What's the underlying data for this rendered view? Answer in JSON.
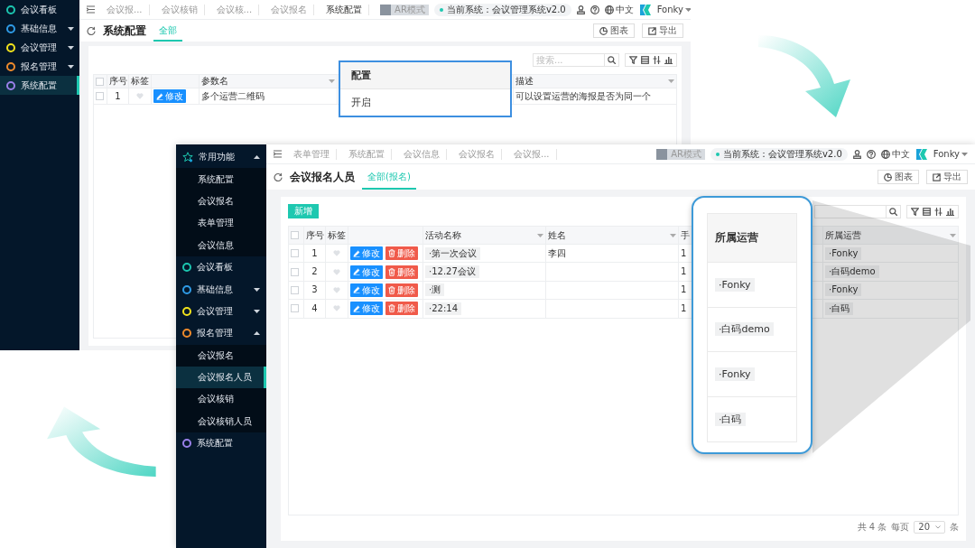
{
  "back_window": {
    "sidebar": [
      {
        "kind": "module",
        "label": "会议看板",
        "color": "#1cc6b0",
        "selected": false
      },
      {
        "kind": "module",
        "label": "基础信息",
        "color": "#2f9be6",
        "selected": false,
        "expanded": false
      },
      {
        "kind": "module",
        "label": "会议管理",
        "color": "#f2e31c",
        "selected": false,
        "expanded": false
      },
      {
        "kind": "module",
        "label": "报名管理",
        "color": "#ee8a2c",
        "selected": false,
        "expanded": false
      },
      {
        "kind": "module",
        "label": "系统配置",
        "color": "#9a80ea",
        "selected": true
      }
    ],
    "open_tabs": [
      {
        "label": "会议报...",
        "selected": false
      },
      {
        "label": "会议核销",
        "selected": false
      },
      {
        "label": "会议核...",
        "selected": false
      },
      {
        "label": "会议报名",
        "selected": false
      },
      {
        "label": "系统配置",
        "selected": true
      }
    ],
    "mode_toggle": {
      "label": "AR模式",
      "on": false
    },
    "system": "当前系统：会议管理系统v2.0",
    "language": "中文",
    "user": "Fonky",
    "page_title": "系统配置",
    "view_tabs": [
      {
        "label": "全部",
        "selected": true
      }
    ],
    "actions": [
      "图表",
      "导出"
    ],
    "search": {
      "placeholder": "搜索..."
    },
    "table": {
      "header_checked": false,
      "columns": [
        "序号",
        "标签",
        "参数名",
        "描述"
      ],
      "rows": [
        {
          "checked": false,
          "index": "1",
          "edit": "修改",
          "param": "多个运营二维码",
          "description": "可以设置运营的海报是否为同一个"
        }
      ]
    }
  },
  "config_callout": {
    "header": "配置",
    "value": "开启"
  },
  "front_window": {
    "sidebar": [
      {
        "kind": "favorites",
        "label": "常用功能",
        "selected": false,
        "expanded": true,
        "children": [
          {
            "label": "系统配置",
            "selected": false
          },
          {
            "label": "会议报名",
            "selected": false
          },
          {
            "label": "表单管理",
            "selected": false
          },
          {
            "label": "会议信息",
            "selected": false
          }
        ]
      },
      {
        "kind": "module",
        "label": "会议看板",
        "color": "#1cc6b0",
        "selected": false
      },
      {
        "kind": "module",
        "label": "基础信息",
        "color": "#2f9be6",
        "selected": false,
        "expanded": false
      },
      {
        "kind": "module",
        "label": "会议管理",
        "color": "#f2e31c",
        "selected": false,
        "expanded": false
      },
      {
        "kind": "module",
        "label": "报名管理",
        "color": "#ee8a2c",
        "selected": false,
        "expanded": true,
        "children": [
          {
            "label": "会议报名",
            "selected": false
          },
          {
            "label": "会议报名人员",
            "selected": true
          },
          {
            "label": "会议核销",
            "selected": false
          },
          {
            "label": "会议核销人员",
            "selected": false
          }
        ]
      },
      {
        "kind": "module",
        "label": "系统配置",
        "color": "#9a80ea",
        "selected": false
      }
    ],
    "open_tabs": [
      {
        "label": "表单管理",
        "selected": false
      },
      {
        "label": "系统配置",
        "selected": false
      },
      {
        "label": "会议信息",
        "selected": false
      },
      {
        "label": "会议报名",
        "selected": false
      },
      {
        "label": "会议报...",
        "selected": false
      }
    ],
    "mode_toggle": {
      "label": "AR模式",
      "on": false
    },
    "system": "当前系统：会议管理系统v2.0",
    "language": "中文",
    "user": "Fonky",
    "page_title": "会议报名人员",
    "view_tabs": [
      {
        "label": "全部(报名)",
        "selected": true
      }
    ],
    "actions": [
      "图表",
      "导出"
    ],
    "new_button": "新增",
    "table": {
      "header_checked": false,
      "columns": [
        "序号",
        "标签",
        "活动名称",
        "姓名",
        "手",
        "所属运营"
      ],
      "rows": [
        {
          "checked": false,
          "index": "1",
          "edit": "修改",
          "delete": "删除",
          "activity": "·第一次会议",
          "name": "李四",
          "partial_column": "1",
          "operator": "·Fonky"
        },
        {
          "checked": false,
          "index": "2",
          "edit": "修改",
          "delete": "删除",
          "activity": "·12.27会议",
          "partial_column": "1",
          "operator": "·白码demo"
        },
        {
          "checked": false,
          "index": "3",
          "edit": "修改",
          "delete": "删除",
          "activity": "·测",
          "partial_column": "1",
          "operator": "·Fonky"
        },
        {
          "checked": false,
          "index": "4",
          "edit": "修改",
          "delete": "删除",
          "activity": "·22:14",
          "partial_column": "1",
          "operator": "·白码"
        }
      ]
    },
    "pagination": {
      "total": "共 4 条",
      "per_page_label": "每页",
      "page_size": "20",
      "unit": "条"
    }
  },
  "operator_callout": {
    "header": "所属运营",
    "items": [
      "·Fonky",
      "·白码demo",
      "·Fonky",
      "·白码"
    ]
  }
}
